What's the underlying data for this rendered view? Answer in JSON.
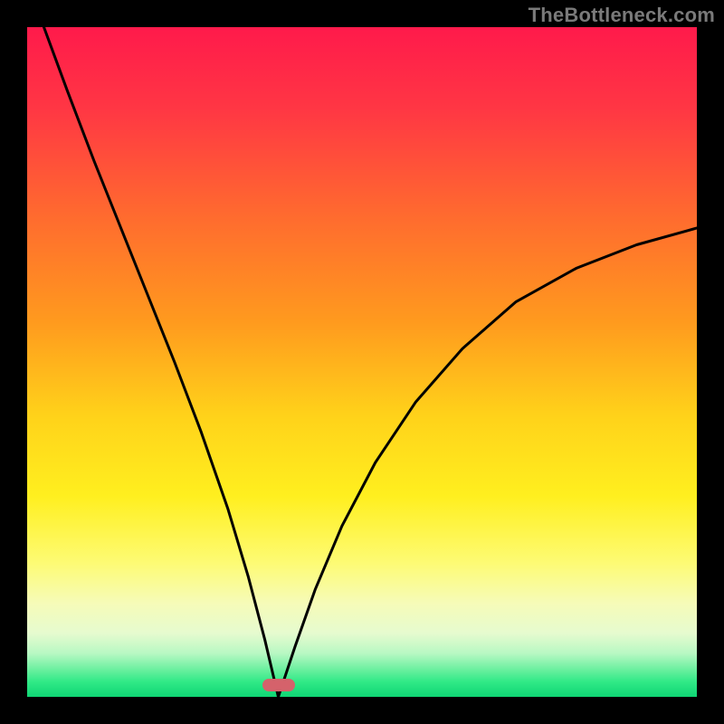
{
  "watermark": {
    "text": "TheBottleneck.com"
  },
  "plot": {
    "inner_size_px": 740,
    "border_px": 30
  },
  "gradient": {
    "stops": [
      {
        "offset": 0.0,
        "color": "#ff1a4b"
      },
      {
        "offset": 0.12,
        "color": "#ff3644"
      },
      {
        "offset": 0.28,
        "color": "#ff6a2f"
      },
      {
        "offset": 0.44,
        "color": "#ff9a1e"
      },
      {
        "offset": 0.58,
        "color": "#ffd21a"
      },
      {
        "offset": 0.7,
        "color": "#ffef1f"
      },
      {
        "offset": 0.8,
        "color": "#fdfb74"
      },
      {
        "offset": 0.86,
        "color": "#f6fbb8"
      },
      {
        "offset": 0.905,
        "color": "#e6fbcf"
      },
      {
        "offset": 0.935,
        "color": "#b8f8c3"
      },
      {
        "offset": 0.958,
        "color": "#6ff0a1"
      },
      {
        "offset": 0.978,
        "color": "#2fe986"
      },
      {
        "offset": 1.0,
        "color": "#0fd574"
      }
    ]
  },
  "marker": {
    "x_frac": 0.375,
    "y_frac": 0.983,
    "color": "#d5626b"
  },
  "curve": {
    "stroke": "#000000",
    "stroke_width": 3
  },
  "chart_data": {
    "type": "line",
    "title": "",
    "xlabel": "",
    "ylabel": "",
    "xlim": [
      0,
      1
    ],
    "ylim": [
      0,
      1
    ],
    "note": "Two-branch bottleneck curve; y-axis is bottleneck severity (1=high/red top, 0=low/green bottom); x-axis is component balance ratio. Minimum at x≈0.375 where y≈0 (marker). Left branch starts at (0.025, 1.00); right branch ends at (1.00, 0.70).",
    "series": [
      {
        "name": "left-branch",
        "x": [
          0.025,
          0.06,
          0.1,
          0.14,
          0.18,
          0.22,
          0.26,
          0.3,
          0.33,
          0.355,
          0.375
        ],
        "y": [
          1.0,
          0.905,
          0.8,
          0.7,
          0.6,
          0.5,
          0.395,
          0.28,
          0.18,
          0.085,
          0.0
        ]
      },
      {
        "name": "right-branch",
        "x": [
          0.375,
          0.4,
          0.43,
          0.47,
          0.52,
          0.58,
          0.65,
          0.73,
          0.82,
          0.91,
          1.0
        ],
        "y": [
          0.0,
          0.075,
          0.16,
          0.255,
          0.35,
          0.44,
          0.52,
          0.59,
          0.64,
          0.675,
          0.7
        ]
      }
    ],
    "marker_point": {
      "x": 0.375,
      "y": 0.017
    },
    "background_scale": "vertical gradient red→orange→yellow→pale→green mapping to y-value"
  }
}
